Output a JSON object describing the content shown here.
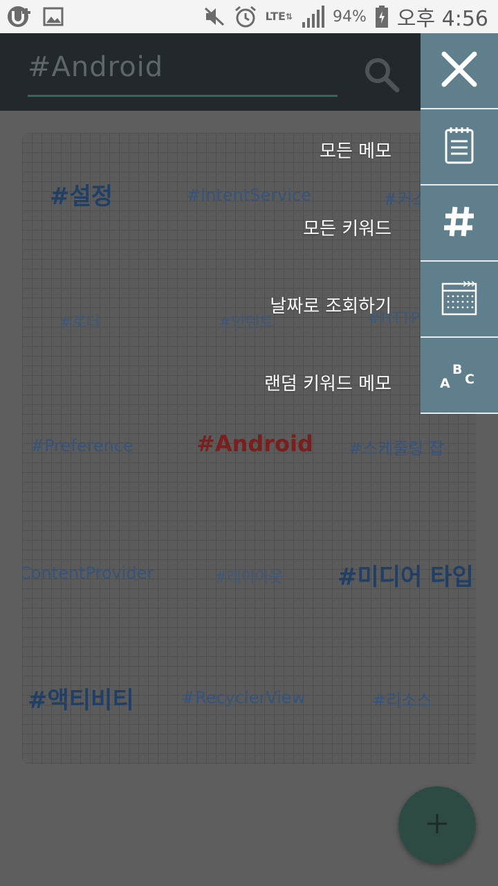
{
  "status_bar": {
    "battery_percent": "94%",
    "clock": "오후 4:56",
    "network": "LTE",
    "icons": [
      "u-plus-icon",
      "image-icon",
      "mute-icon",
      "alarm-icon",
      "signal-icon",
      "battery-icon"
    ]
  },
  "search": {
    "value": "#Android"
  },
  "keywords": [
    {
      "text": "#설정",
      "style": "big"
    },
    {
      "text": "#IntentService",
      "style": "mid"
    },
    {
      "text": "#커스",
      "style": "mid"
    },
    {
      "text": "#로더",
      "style": "small"
    },
    {
      "text": "#인텐트",
      "style": "small"
    },
    {
      "text": "#HTTP",
      "style": "small"
    },
    {
      "text": "#Preference",
      "style": "mid"
    },
    {
      "text": "#Android",
      "style": "red"
    },
    {
      "text": "#스케줄링 잡",
      "style": "mid"
    },
    {
      "text": "ContentProvider",
      "style": "mid"
    },
    {
      "text": "#레이아웃",
      "style": "small"
    },
    {
      "text": "#미디어 타입",
      "style": "big"
    },
    {
      "text": "#액티비티",
      "style": "big"
    },
    {
      "text": "#RecyclerView",
      "style": "mid"
    },
    {
      "text": "#리소스",
      "style": "mid"
    }
  ],
  "menu": {
    "items": [
      {
        "label": "모든 메모",
        "icon": "notepad-icon"
      },
      {
        "label": "모든 키워드",
        "icon": "hash-icon"
      },
      {
        "label": "날짜로 조회하기",
        "icon": "calendar-icon"
      },
      {
        "label": "랜덤 키워드 메모",
        "icon": "abc-icon"
      }
    ],
    "close_icon": "close-icon",
    "random_icon_letters": {
      "a": "A",
      "b": "B",
      "c": "C"
    }
  },
  "fab": {
    "icon": "plus-icon"
  },
  "colors": {
    "appbar": "#22282c",
    "menu": "#5f7f8c",
    "accent": "#2f6b5a",
    "highlight_keyword": "#c62828",
    "keyword": "#1e5aa0"
  }
}
